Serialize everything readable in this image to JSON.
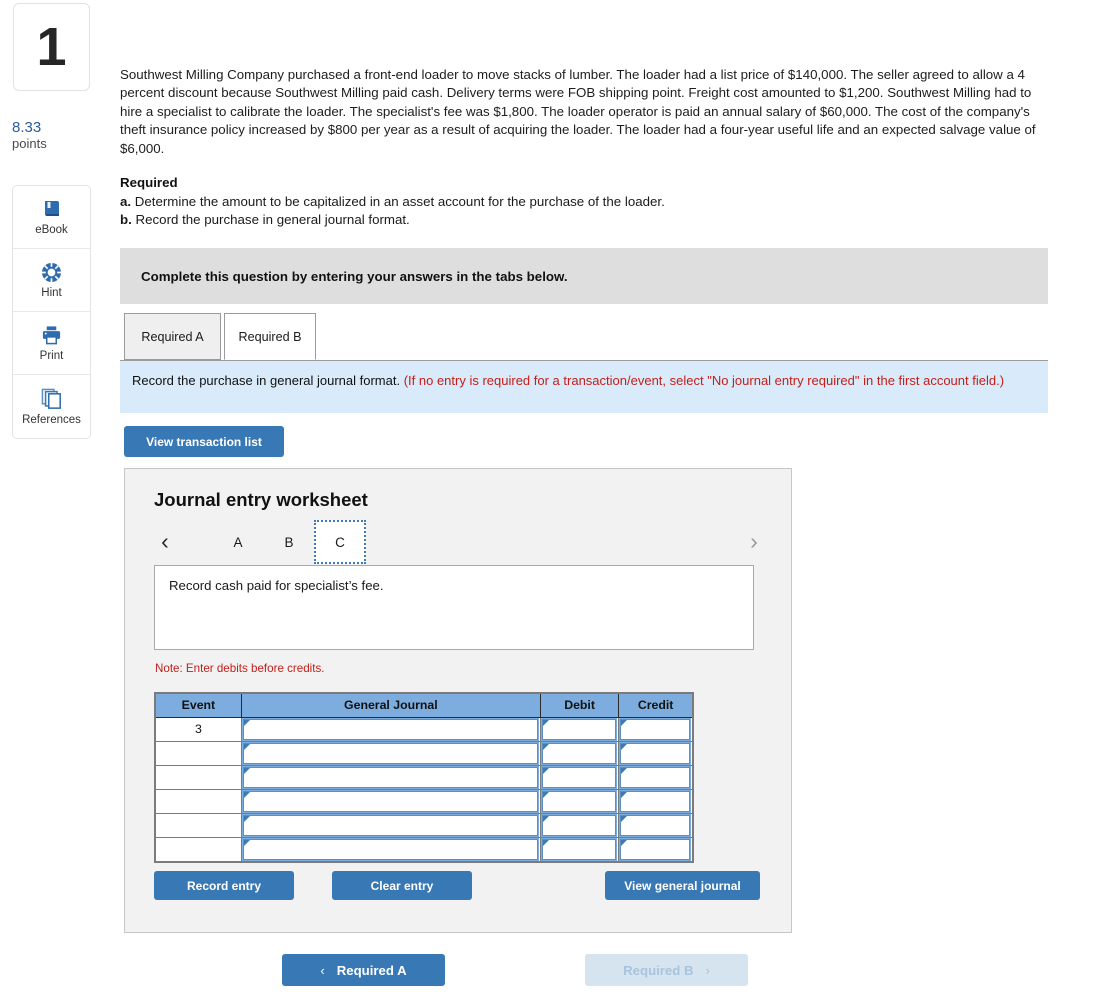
{
  "question": {
    "number": "1",
    "points_value": "8.33",
    "points_label": "points"
  },
  "tools": [
    {
      "label": "eBook",
      "icon": "book-icon"
    },
    {
      "label": "Hint",
      "icon": "lifebuoy-icon"
    },
    {
      "label": "Print",
      "icon": "printer-icon"
    },
    {
      "label": "References",
      "icon": "copy-pages-icon"
    }
  ],
  "stem": "Southwest Milling Company purchased a front-end loader to move stacks of lumber. The loader had a list price of $140,000. The seller agreed to allow a 4 percent discount because Southwest Milling paid cash. Delivery terms were FOB shipping point. Freight cost amounted to $1,200. Southwest Milling had to hire a specialist to calibrate the loader. The specialist's fee was $1,800. The loader operator is paid an annual salary of $60,000. The cost of the company's theft insurance policy increased by $800 per year as a result of acquiring the loader. The loader had a four-year useful life and an expected salvage value of $6,000.",
  "required": {
    "heading": "Required",
    "item_a_marker": "a.",
    "item_a_text": "Determine the amount to be capitalized in an asset account for the purchase of the loader.",
    "item_b_marker": "b.",
    "item_b_text": "Record the purchase in general journal format."
  },
  "complete_bar": "Complete this question by entering your answers in the tabs below.",
  "tabs": [
    {
      "label": "Required A",
      "active": false
    },
    {
      "label": "Required B",
      "active": true
    }
  ],
  "instruction": {
    "bold_text": "Record the purchase in general journal format.",
    "red_text": "(If no entry is required for a transaction/event, select \"No journal entry required\" in the first account field.)"
  },
  "view_transaction_list_label": "View transaction list",
  "worksheet": {
    "title": "Journal entry worksheet",
    "prev_arrow": "‹",
    "next_arrow": "›",
    "letter_tabs": [
      {
        "label": "A",
        "selected": false
      },
      {
        "label": "B",
        "selected": false
      },
      {
        "label": "C",
        "selected": true
      }
    ],
    "description": "Record cash paid for specialist’s fee.",
    "note": "Note: Enter debits before credits.",
    "table": {
      "headers": [
        "Event",
        "General Journal",
        "Debit",
        "Credit"
      ],
      "rows": [
        {
          "event": "3",
          "general_journal": "",
          "debit": "",
          "credit": ""
        },
        {
          "event": "",
          "general_journal": "",
          "debit": "",
          "credit": ""
        },
        {
          "event": "",
          "general_journal": "",
          "debit": "",
          "credit": ""
        },
        {
          "event": "",
          "general_journal": "",
          "debit": "",
          "credit": ""
        },
        {
          "event": "",
          "general_journal": "",
          "debit": "",
          "credit": ""
        },
        {
          "event": "",
          "general_journal": "",
          "debit": "",
          "credit": ""
        }
      ]
    },
    "buttons": {
      "record_entry": "Record entry",
      "clear_entry": "Clear entry",
      "view_general_journal": "View general journal"
    }
  },
  "pager": {
    "prev_label": "Required A",
    "prev_chevron": "‹",
    "next_label": "Required B",
    "next_chevron": "›"
  },
  "colors": {
    "accent_blue": "#3878b4",
    "table_header_blue": "#7cadde",
    "instruction_panel_blue": "#d9ebfa",
    "red_note": "#c2201b",
    "points_blue": "#2b5c9b"
  }
}
